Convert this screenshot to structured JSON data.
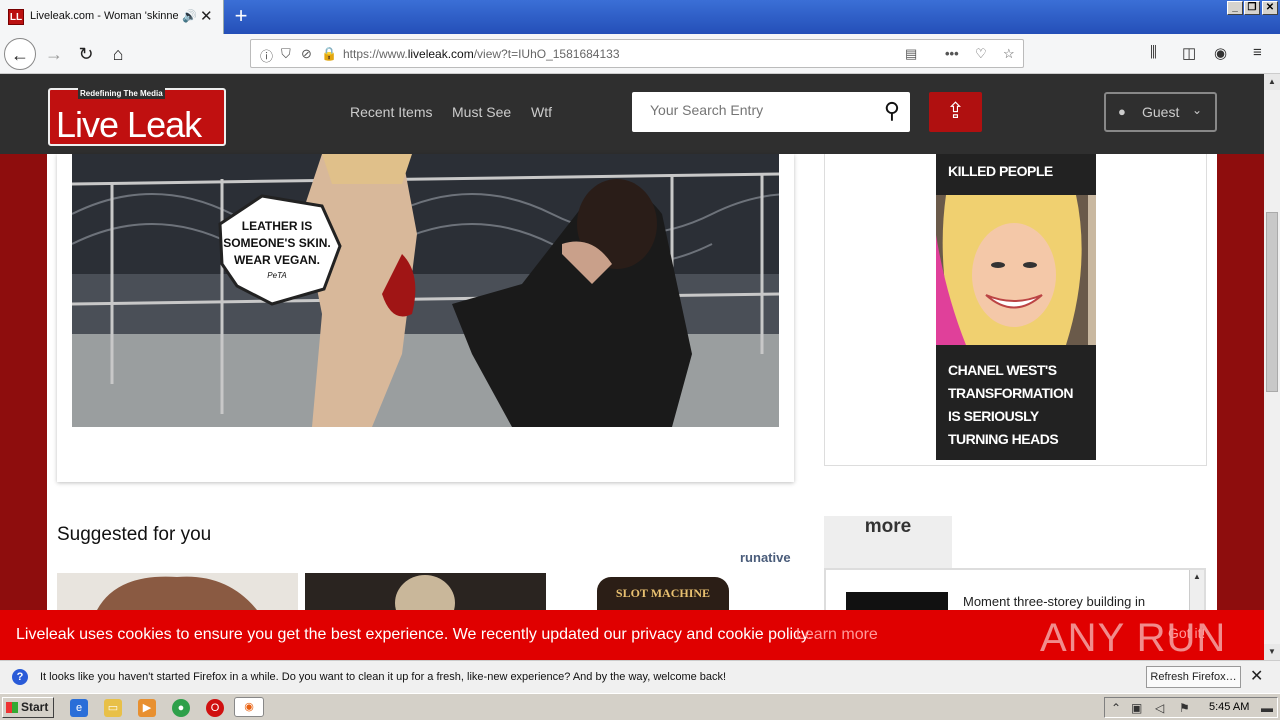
{
  "browser": {
    "tab_title": "Liveleak.com - Woman 'skinned",
    "tab_favicon": "LL",
    "url_prefix": "https://www.",
    "url_domain": "liveleak.com",
    "url_path": "/view?t=IUhO_1581684133",
    "window_buttons": [
      "_",
      "❐",
      "✕"
    ]
  },
  "site": {
    "logo_tagline": "Redefining The Media",
    "logo_name": "Live Leak",
    "nav": [
      "Recent Items",
      "Must See",
      "Wtf"
    ],
    "search_placeholder": "Your Search Entry",
    "guest_label": "Guest"
  },
  "video": {
    "sign_lines": [
      "LEATHER IS",
      "SOMEONE'S SKIN.",
      "WEAR VEGAN."
    ],
    "sign_brand": "PeTA"
  },
  "ad": {
    "headline": "KILLED PEOPLE",
    "caption": "CHANEL WEST'S TRANSFORMATION IS SERIOUSLY TURNING HEADS"
  },
  "suggested": {
    "title": "Suggested for you",
    "provider": "runative",
    "thumb3_label": "SLOT MACHINE"
  },
  "more": {
    "tab_label": "more",
    "first_item": "Moment three-storey building in"
  },
  "cookie": {
    "text": "Liveleak uses cookies to ensure you get the best experience. We recently updated our privacy and cookie policy.",
    "link": "Learn more",
    "button": "Got it!",
    "watermark": "ANY RUN"
  },
  "notification": {
    "text": "It looks like you haven't started Firefox in a while. Do you want to clean it up for a fresh, like-new experience? And by the way, welcome back!",
    "button": "Refresh Firefox…"
  },
  "taskbar": {
    "start_label": "Start",
    "clock": "5:45 AM"
  }
}
